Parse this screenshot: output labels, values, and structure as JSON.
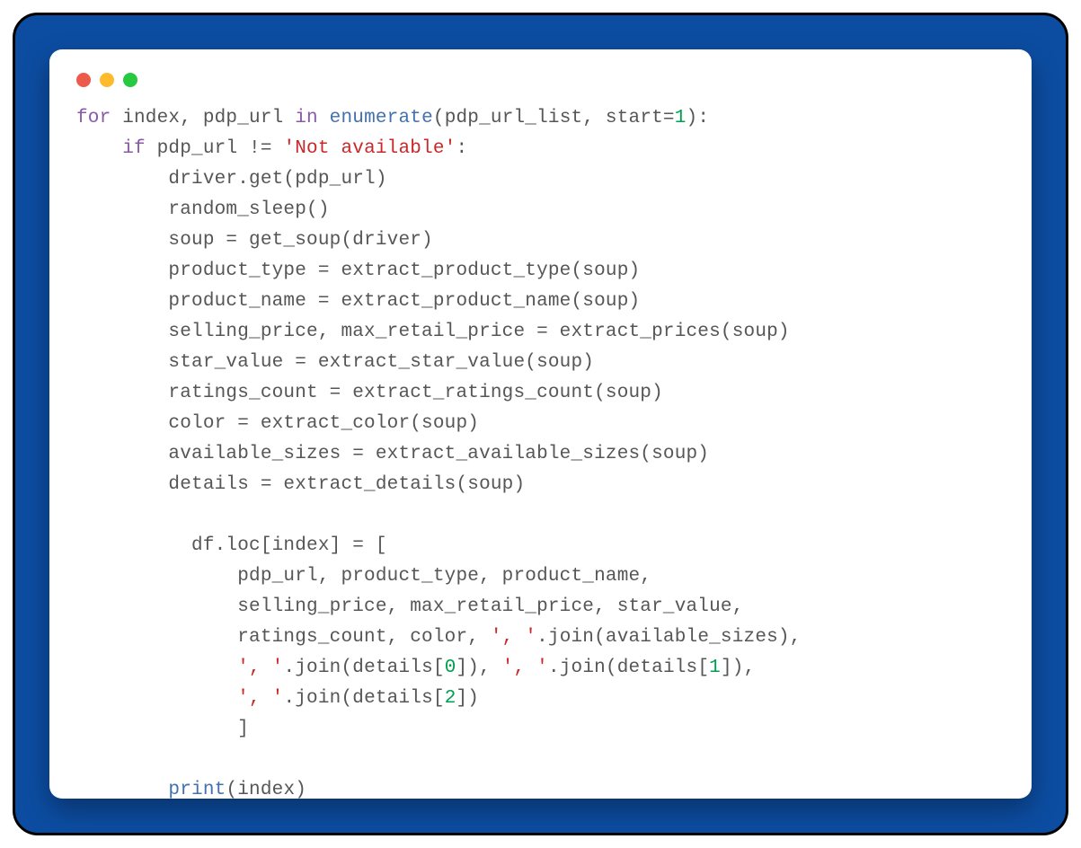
{
  "colors": {
    "frame_bg": "#0c4da2",
    "frame_border": "#000000",
    "window_bg": "#ffffff",
    "dot_red": "#ed594a",
    "dot_yellow": "#fdbb2d",
    "dot_green": "#26c940",
    "code_default": "#565656",
    "code_keyword": "#8959a8",
    "code_funcname": "#4271ae",
    "code_string": "#c82829",
    "code_number": "#00a050"
  },
  "code": {
    "language": "python",
    "lines": [
      [
        [
          "kw",
          "for"
        ],
        [
          "op",
          " index, pdp_url "
        ],
        [
          "kw",
          "in"
        ],
        [
          "op",
          " "
        ],
        [
          "fn",
          "enumerate"
        ],
        [
          "op",
          "(pdp_url_list, start="
        ],
        [
          "num",
          "1"
        ],
        [
          "op",
          "):"
        ]
      ],
      [
        [
          "op",
          "    "
        ],
        [
          "kw",
          "if"
        ],
        [
          "op",
          " pdp_url != "
        ],
        [
          "str",
          "'Not available'"
        ],
        [
          "op",
          ":"
        ]
      ],
      [
        [
          "op",
          "        driver.get(pdp_url)"
        ]
      ],
      [
        [
          "op",
          "        random_sleep()"
        ]
      ],
      [
        [
          "op",
          "        soup = get_soup(driver)"
        ]
      ],
      [
        [
          "op",
          "        product_type = extract_product_type(soup)"
        ]
      ],
      [
        [
          "op",
          "        product_name = extract_product_name(soup)"
        ]
      ],
      [
        [
          "op",
          "        selling_price, max_retail_price = extract_prices(soup)"
        ]
      ],
      [
        [
          "op",
          "        star_value = extract_star_value(soup)"
        ]
      ],
      [
        [
          "op",
          "        ratings_count = extract_ratings_count(soup)"
        ]
      ],
      [
        [
          "op",
          "        color = extract_color(soup)"
        ]
      ],
      [
        [
          "op",
          "        available_sizes = extract_available_sizes(soup)"
        ]
      ],
      [
        [
          "op",
          "        details = extract_details(soup)"
        ]
      ],
      [
        [
          "op",
          ""
        ]
      ],
      [
        [
          "op",
          "          df.loc[index] = ["
        ]
      ],
      [
        [
          "op",
          "              pdp_url, product_type, product_name,"
        ]
      ],
      [
        [
          "op",
          "              selling_price, max_retail_price, star_value,"
        ]
      ],
      [
        [
          "op",
          "              ratings_count, color, "
        ],
        [
          "str",
          "', '"
        ],
        [
          "op",
          ".join(available_sizes),"
        ]
      ],
      [
        [
          "op",
          "              "
        ],
        [
          "str",
          "', '"
        ],
        [
          "op",
          ".join(details["
        ],
        [
          "num",
          "0"
        ],
        [
          "op",
          "]), "
        ],
        [
          "str",
          "', '"
        ],
        [
          "op",
          ".join(details["
        ],
        [
          "num",
          "1"
        ],
        [
          "op",
          "]),"
        ]
      ],
      [
        [
          "op",
          "              "
        ],
        [
          "str",
          "', '"
        ],
        [
          "op",
          ".join(details["
        ],
        [
          "num",
          "2"
        ],
        [
          "op",
          "])"
        ]
      ],
      [
        [
          "op",
          "              ]"
        ]
      ],
      [
        [
          "op",
          ""
        ]
      ],
      [
        [
          "op",
          "        "
        ],
        [
          "fn",
          "print"
        ],
        [
          "op",
          "(index)"
        ]
      ]
    ]
  }
}
